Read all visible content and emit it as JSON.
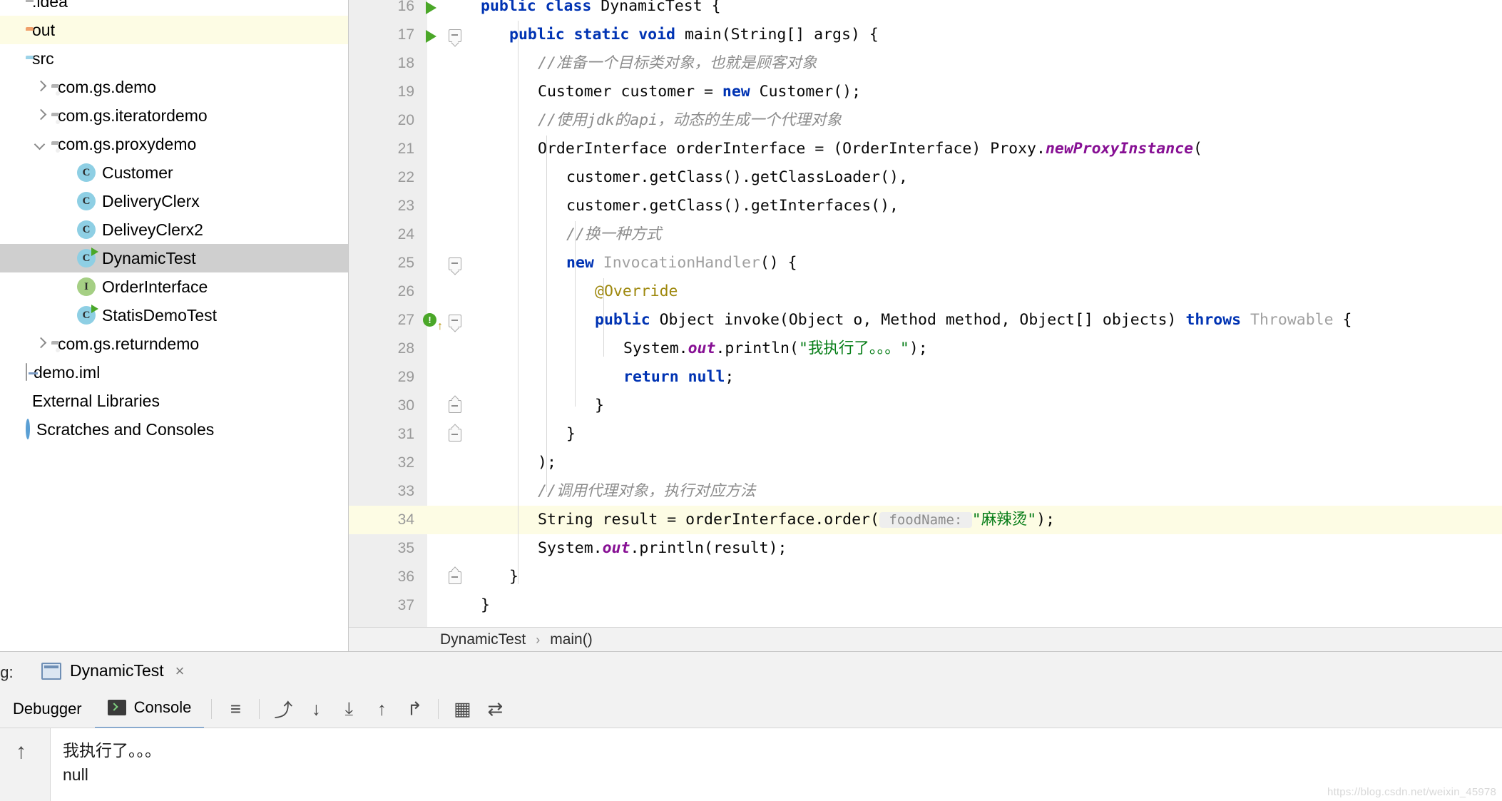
{
  "sidebar": {
    "items": [
      {
        "label": ".idea",
        "type": "folder-plain",
        "indent": 0,
        "arrow": "none",
        "state": "clipped"
      },
      {
        "label": "out",
        "type": "folder-out",
        "indent": 0,
        "arrow": "none",
        "state": "highlight"
      },
      {
        "label": "src",
        "type": "folder-src",
        "indent": 0,
        "arrow": "none",
        "state": "normal"
      },
      {
        "label": "com.gs.demo",
        "type": "package",
        "indent": 1,
        "arrow": "right",
        "state": "normal"
      },
      {
        "label": "com.gs.iteratordemo",
        "type": "package",
        "indent": 1,
        "arrow": "right",
        "state": "normal"
      },
      {
        "label": "com.gs.proxydemo",
        "type": "package",
        "indent": 1,
        "arrow": "down",
        "state": "normal"
      },
      {
        "label": "Customer",
        "type": "class",
        "indent": 2,
        "arrow": "none",
        "state": "normal"
      },
      {
        "label": "DeliveryClerx",
        "type": "class",
        "indent": 2,
        "arrow": "none",
        "state": "normal"
      },
      {
        "label": "DeliveyClerx2",
        "type": "class",
        "indent": 2,
        "arrow": "none",
        "state": "normal"
      },
      {
        "label": "DynamicTest",
        "type": "class-run",
        "indent": 2,
        "arrow": "none",
        "state": "selected"
      },
      {
        "label": "OrderInterface",
        "type": "interface",
        "indent": 2,
        "arrow": "none",
        "state": "normal"
      },
      {
        "label": "StatisDemoTest",
        "type": "class-run",
        "indent": 2,
        "arrow": "none",
        "state": "normal"
      },
      {
        "label": "com.gs.returndemo",
        "type": "package",
        "indent": 1,
        "arrow": "right",
        "state": "normal"
      },
      {
        "label": "demo.iml",
        "type": "file",
        "indent": 0,
        "arrow": "none",
        "state": "normal"
      },
      {
        "label": "External Libraries",
        "type": "library",
        "indent": 0,
        "arrow": "none",
        "state": "normal"
      },
      {
        "label": "Scratches and Consoles",
        "type": "scratches",
        "indent": 0,
        "arrow": "none",
        "state": "normal"
      }
    ]
  },
  "editor": {
    "file": "DynamicTest.java",
    "first_line_number": 16,
    "highlighted_line": 34,
    "lines": [
      {
        "n": 16,
        "gutter": "run",
        "fold": "none",
        "indent": 0,
        "tokens": [
          {
            "t": "public ",
            "c": "kw"
          },
          {
            "t": "class ",
            "c": "kw"
          },
          {
            "t": "DynamicTest {",
            "c": "plain"
          }
        ]
      },
      {
        "n": 17,
        "gutter": "run",
        "fold": "start",
        "indent": 1,
        "tokens": [
          {
            "t": "public ",
            "c": "kw"
          },
          {
            "t": "static ",
            "c": "kw"
          },
          {
            "t": "void ",
            "c": "kw"
          },
          {
            "t": "main(String[] args) {",
            "c": "plain"
          }
        ]
      },
      {
        "n": 18,
        "gutter": "none",
        "fold": "none",
        "indent": 2,
        "tokens": [
          {
            "t": "//准备一个目标类对象，也就是顾客对象",
            "c": "cmt"
          }
        ]
      },
      {
        "n": 19,
        "gutter": "none",
        "fold": "none",
        "indent": 2,
        "tokens": [
          {
            "t": "Customer customer = ",
            "c": "plain"
          },
          {
            "t": "new ",
            "c": "kw"
          },
          {
            "t": "Customer();",
            "c": "plain"
          }
        ]
      },
      {
        "n": 20,
        "gutter": "none",
        "fold": "none",
        "indent": 2,
        "tokens": [
          {
            "t": "//使用jdk的api，动态的生成一个代理对象",
            "c": "cmt"
          }
        ]
      },
      {
        "n": 21,
        "gutter": "none",
        "fold": "none",
        "indent": 2,
        "tokens": [
          {
            "t": "OrderInterface orderInterface = (OrderInterface) Proxy.",
            "c": "plain"
          },
          {
            "t": "newProxyInstance",
            "c": "stat"
          },
          {
            "t": "(",
            "c": "plain"
          }
        ]
      },
      {
        "n": 22,
        "gutter": "none",
        "fold": "none",
        "indent": 3,
        "tokens": [
          {
            "t": "customer.getClass().getClassLoader(),",
            "c": "plain"
          }
        ]
      },
      {
        "n": 23,
        "gutter": "none",
        "fold": "none",
        "indent": 3,
        "tokens": [
          {
            "t": "customer.getClass().getInterfaces(),",
            "c": "plain"
          }
        ]
      },
      {
        "n": 24,
        "gutter": "none",
        "fold": "none",
        "indent": 3,
        "tokens": [
          {
            "t": "//换一种方式",
            "c": "cmt"
          }
        ]
      },
      {
        "n": 25,
        "gutter": "none",
        "fold": "start",
        "indent": 3,
        "tokens": [
          {
            "t": "new ",
            "c": "kw"
          },
          {
            "t": "InvocationHandler",
            "c": "muted"
          },
          {
            "t": "() {",
            "c": "plain"
          }
        ]
      },
      {
        "n": 26,
        "gutter": "none",
        "fold": "none",
        "indent": 4,
        "tokens": [
          {
            "t": "@Override",
            "c": "anno"
          }
        ]
      },
      {
        "n": 27,
        "gutter": "warn",
        "fold": "start",
        "indent": 4,
        "tokens": [
          {
            "t": "public ",
            "c": "kw"
          },
          {
            "t": "Object invoke(Object o, Method method, Object[] objects) ",
            "c": "plain"
          },
          {
            "t": "throws ",
            "c": "kw"
          },
          {
            "t": "Throwable",
            "c": "muted"
          },
          {
            "t": " {",
            "c": "plain"
          }
        ]
      },
      {
        "n": 28,
        "gutter": "none",
        "fold": "none",
        "indent": 5,
        "tokens": [
          {
            "t": "System.",
            "c": "plain"
          },
          {
            "t": "out",
            "c": "stat"
          },
          {
            "t": ".println(",
            "c": "plain"
          },
          {
            "t": "\"我执行了。。。\"",
            "c": "str"
          },
          {
            "t": ");",
            "c": "plain"
          }
        ]
      },
      {
        "n": 29,
        "gutter": "none",
        "fold": "none",
        "indent": 5,
        "tokens": [
          {
            "t": "return ",
            "c": "kw"
          },
          {
            "t": "null",
            "c": "kw"
          },
          {
            "t": ";",
            "c": "plain"
          }
        ]
      },
      {
        "n": 30,
        "gutter": "none",
        "fold": "end",
        "indent": 4,
        "tokens": [
          {
            "t": "}",
            "c": "plain"
          }
        ]
      },
      {
        "n": 31,
        "gutter": "none",
        "fold": "end",
        "indent": 3,
        "tokens": [
          {
            "t": "}",
            "c": "plain"
          }
        ]
      },
      {
        "n": 32,
        "gutter": "none",
        "fold": "none",
        "indent": 2,
        "tokens": [
          {
            "t": ");",
            "c": "plain"
          }
        ]
      },
      {
        "n": 33,
        "gutter": "none",
        "fold": "none",
        "indent": 2,
        "tokens": [
          {
            "t": "//调用代理对象，执行对应方法",
            "c": "cmt"
          }
        ]
      },
      {
        "n": 34,
        "gutter": "none",
        "fold": "none",
        "indent": 2,
        "highlight": true,
        "tokens": [
          {
            "t": "String result = orderInterface.order(",
            "c": "plain"
          },
          {
            "t": " foodName: ",
            "c": "hint"
          },
          {
            "t": "\"麻辣烫\"",
            "c": "str"
          },
          {
            "t": ");",
            "c": "plain"
          }
        ]
      },
      {
        "n": 35,
        "gutter": "none",
        "fold": "none",
        "indent": 2,
        "tokens": [
          {
            "t": "System.",
            "c": "plain"
          },
          {
            "t": "out",
            "c": "stat"
          },
          {
            "t": ".println(result);",
            "c": "plain"
          }
        ]
      },
      {
        "n": 36,
        "gutter": "none",
        "fold": "end",
        "indent": 1,
        "tokens": [
          {
            "t": "}",
            "c": "plain"
          }
        ]
      },
      {
        "n": 37,
        "gutter": "none",
        "fold": "none",
        "indent": 0,
        "tokens": [
          {
            "t": "}",
            "c": "plain"
          }
        ]
      }
    ]
  },
  "breadcrumb": {
    "class": "DynamicTest",
    "separator": "›",
    "method": "main()"
  },
  "debug": {
    "panel_label": "ug:",
    "tab_title": "DynamicTest",
    "tab_close": "×",
    "subtabs": [
      {
        "label": "Debugger",
        "active": false,
        "icon": "none"
      },
      {
        "label": "Console",
        "active": true,
        "icon": "console-icon"
      }
    ],
    "toolbar_buttons": [
      {
        "name": "layout-settings-icon",
        "glyph": "≡"
      },
      {
        "name": "step-over-icon",
        "glyph": "⤴"
      },
      {
        "name": "step-into-icon",
        "glyph": "↓"
      },
      {
        "name": "force-step-into-icon",
        "glyph": "⤓"
      },
      {
        "name": "step-out-icon",
        "glyph": "↑"
      },
      {
        "name": "run-to-cursor-icon",
        "glyph": "↱"
      },
      {
        "name": "evaluate-expression-icon",
        "glyph": "▦"
      },
      {
        "name": "mute-breakpoints-icon",
        "glyph": "⇄"
      }
    ],
    "console_output": [
      "我执行了。。。",
      "null"
    ]
  },
  "watermark": "https://blog.csdn.net/weixin_45978"
}
